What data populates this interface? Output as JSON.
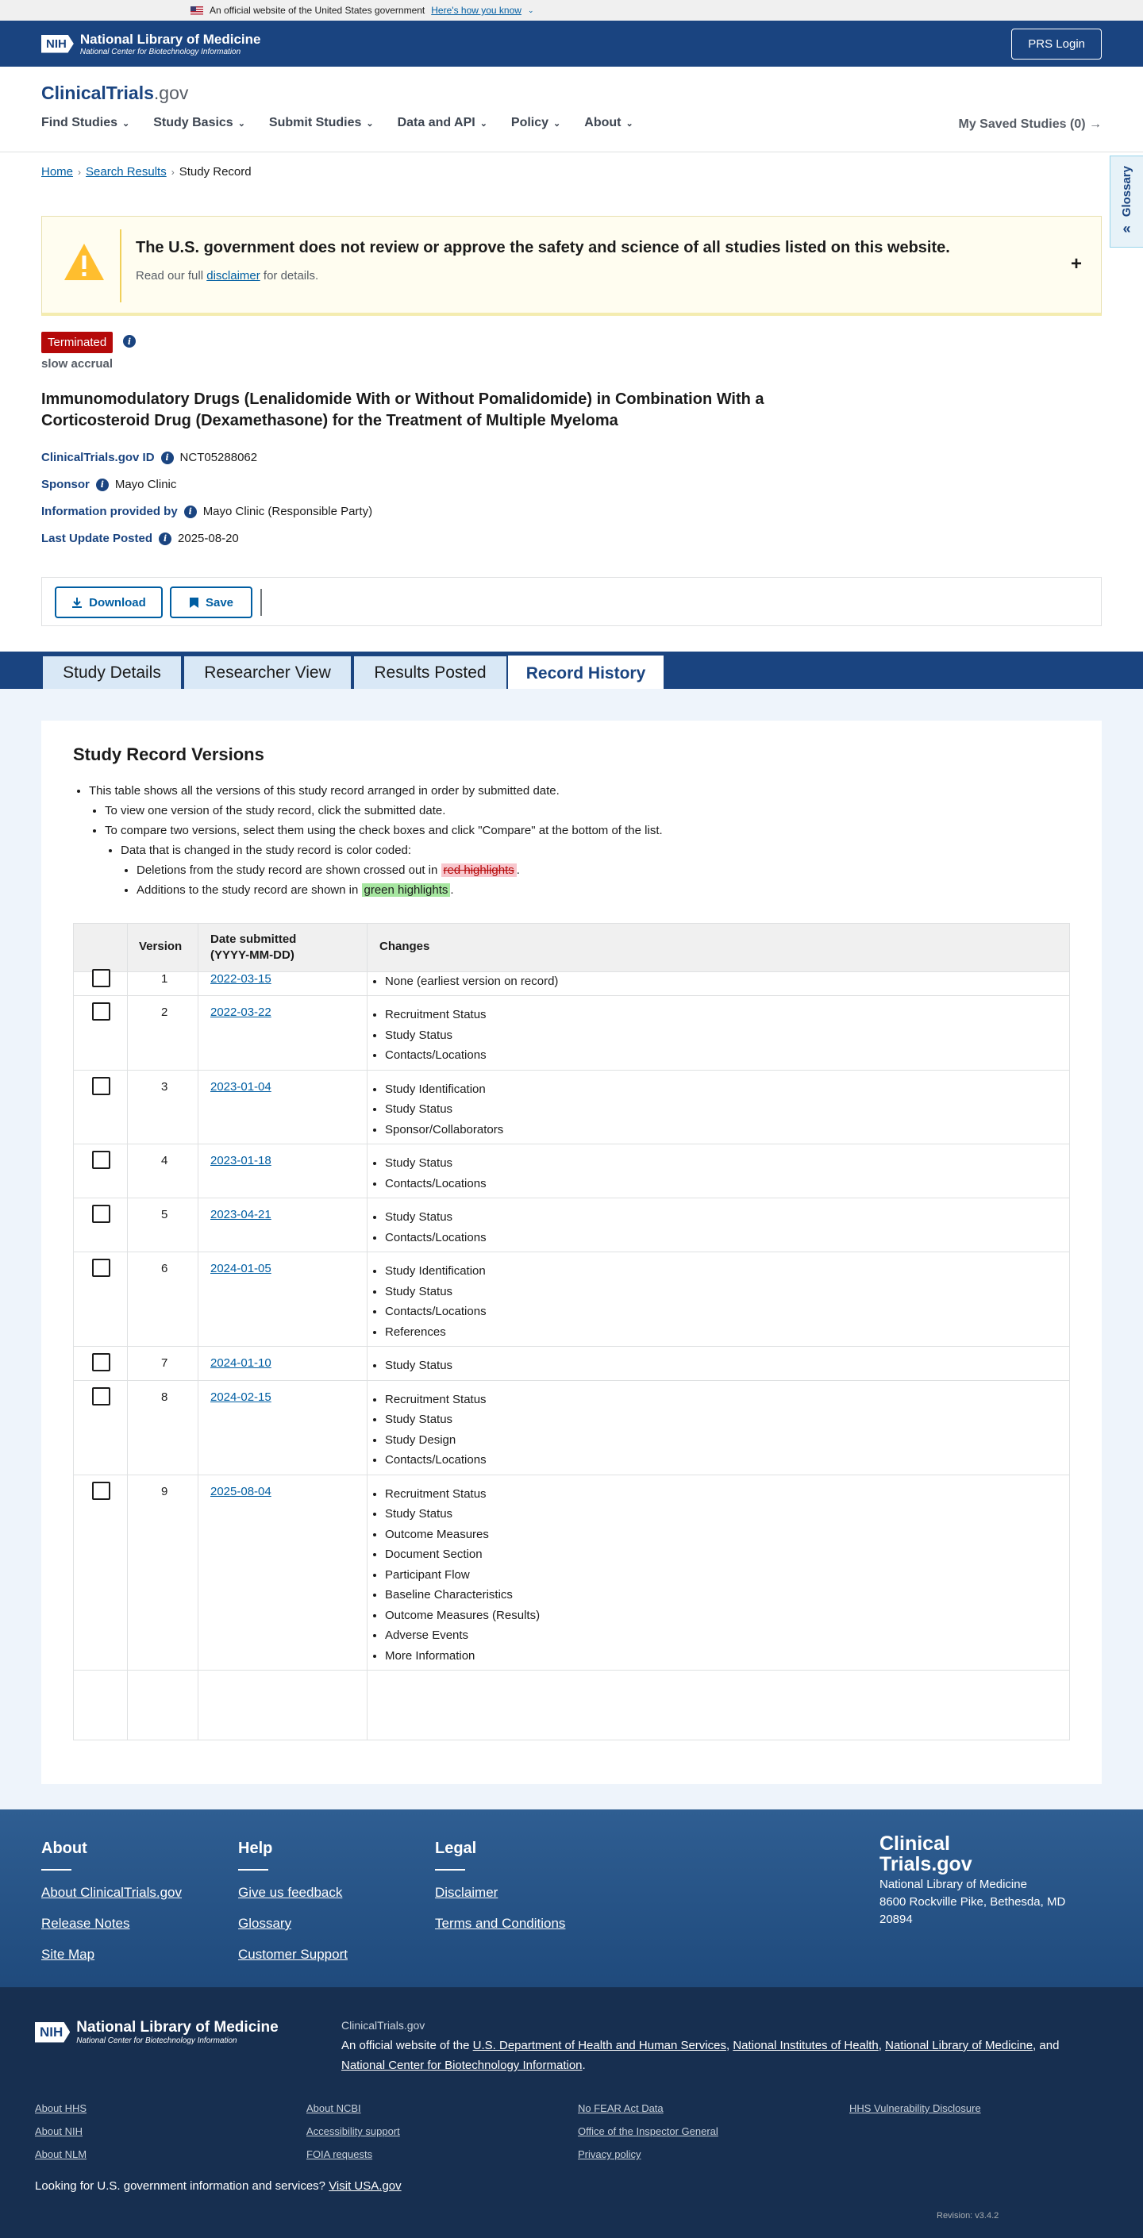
{
  "gov_banner": {
    "text": "An official website of the United States government",
    "link": "Here's how you know"
  },
  "nih_header": {
    "badge": "NIH",
    "title": "National Library of Medicine",
    "subtitle": "National Center for Biotechnology Information",
    "prs_login": "PRS Login"
  },
  "site": {
    "logo_main": "ClinicalTrials",
    "logo_suffix": ".gov"
  },
  "menu": [
    "Find Studies",
    "Study Basics",
    "Submit Studies",
    "Data and API",
    "Policy",
    "About"
  ],
  "saved_studies": "My Saved Studies (0)",
  "breadcrumb": [
    "Home",
    "Search Results",
    "Study Record"
  ],
  "glossary": "Glossary",
  "alert": {
    "title": "The U.S. government does not review or approve the safety and science of all studies listed on this website.",
    "body_before": "Read our full",
    "body_link": "disclaimer",
    "body_after": "for details."
  },
  "study": {
    "status": "Terminated",
    "why_stopped": "slow accrual",
    "title": "Immunomodulatory Drugs (Lenalidomide With or Without Pomalidomide) in Combination With a Corticosteroid Drug (Dexamethasone) for the Treatment of Multiple Myeloma",
    "id_label": "ClinicalTrials.gov ID",
    "id": "NCT05288062",
    "sponsor_label": "Sponsor",
    "sponsor": "Mayo Clinic",
    "info_label": "Information provided by",
    "info": "Mayo Clinic (Responsible Party)",
    "update_label": "Last Update Posted",
    "update": "2025-08-20"
  },
  "actions": {
    "download": "Download",
    "save": "Save"
  },
  "tabs": [
    "Study Details",
    "Researcher View",
    "Results Posted",
    "Record History"
  ],
  "versions_section": {
    "heading": "Study Record Versions",
    "note1": "This table shows all the versions of this study record arranged in order by submitted date.",
    "note2": "To view one version of the study record, click the submitted date.",
    "note3": "To compare two versions, select them using the check boxes and click \"Compare\" at the bottom of the list.",
    "note4": "Data that is changed in the study record is color coded:",
    "note5_before": "Deletions from the study record are shown crossed out in",
    "note5_hl": "red highlights",
    "note6_before": "Additions to the study record are shown in",
    "note6_hl": "green highlights",
    "col_version": "Version",
    "col_date": "Date submitted (YYYY-MM-DD)",
    "col_changes": "Changes",
    "rows": [
      {
        "version": "1",
        "date": "2022-03-15",
        "changes": [
          "None (earliest version on record)"
        ]
      },
      {
        "version": "2",
        "date": "2022-03-22",
        "changes": [
          "Recruitment Status",
          "Study Status",
          "Contacts/Locations"
        ]
      },
      {
        "version": "3",
        "date": "2023-01-04",
        "changes": [
          "Study Identification",
          "Study Status",
          "Sponsor/Collaborators"
        ]
      },
      {
        "version": "4",
        "date": "2023-01-18",
        "changes": [
          "Study Status",
          "Contacts/Locations"
        ]
      },
      {
        "version": "5",
        "date": "2023-04-21",
        "changes": [
          "Study Status",
          "Contacts/Locations"
        ]
      },
      {
        "version": "6",
        "date": "2024-01-05",
        "changes": [
          "Study Identification",
          "Study Status",
          "Contacts/Locations",
          "References"
        ]
      },
      {
        "version": "7",
        "date": "2024-01-10",
        "changes": [
          "Study Status"
        ]
      },
      {
        "version": "8",
        "date": "2024-02-15",
        "changes": [
          "Recruitment Status",
          "Study Status",
          "Study Design",
          "Contacts/Locations"
        ]
      },
      {
        "version": "9",
        "date": "2025-08-04",
        "changes": [
          "Recruitment Status",
          "Study Status",
          "Outcome Measures",
          "Document Section",
          "Participant Flow",
          "Baseline Characteristics",
          "Outcome Measures (Results)",
          "Adverse Events",
          "More Information"
        ]
      }
    ]
  },
  "footer": {
    "about_title": "About",
    "about_links": [
      "About ClinicalTrials.gov",
      "Release Notes",
      "Site Map"
    ],
    "help_title": "Help",
    "help_links": [
      "Give us feedback",
      "Glossary",
      "Customer Support"
    ],
    "legal_title": "Legal",
    "legal_links": [
      "Disclaimer",
      "Terms and Conditions"
    ],
    "logo_line1": "Clinical",
    "logo_line2": "Trials.gov",
    "address1": "National Library of Medicine",
    "address2": "8600 Rockville Pike, Bethesda, MD",
    "address3": "20894"
  },
  "footer_bottom": {
    "site": "ClinicalTrials.gov",
    "official_prefix": "An official website of the",
    "org1": "U.S. Department of Health and Human Services",
    "org2": "National Institutes of Health",
    "org3": "National Library of Medicine",
    "and_text": "and",
    "org4": "National Center for Biotechnology Information",
    "col1": [
      "About HHS",
      "About NIH",
      "About NLM"
    ],
    "col2": [
      "About NCBI",
      "Accessibility support",
      "FOIA requests"
    ],
    "col3": [
      "No FEAR Act Data",
      "Office of the Inspector General",
      "Privacy policy"
    ],
    "col4": [
      "HHS Vulnerability Disclosure"
    ],
    "usa_text": "Looking for U.S. government information and services?",
    "usa_link": "Visit USA.gov",
    "revision": "Revision: v3.4.2"
  }
}
